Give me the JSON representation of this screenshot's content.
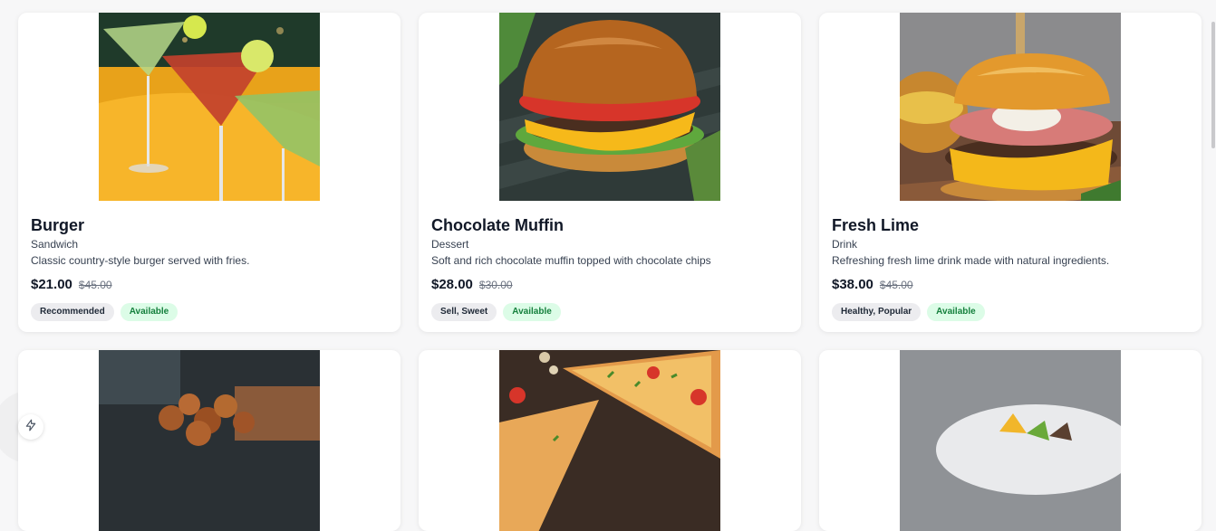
{
  "products": [
    {
      "name": "Burger",
      "category": "Sandwich",
      "description": "Classic country-style burger served with fries.",
      "price": "$21.00",
      "old_price": "$45.00",
      "tag": "Recommended",
      "status": "Available"
    },
    {
      "name": "Chocolate Muffin",
      "category": "Dessert",
      "description": "Soft and rich chocolate muffin topped with chocolate chips",
      "price": "$28.00",
      "old_price": "$30.00",
      "tag": "Sell, Sweet",
      "status": "Available"
    },
    {
      "name": "Fresh Lime",
      "category": "Drink",
      "description": "Refreshing fresh lime drink made with natural ingredients.",
      "price": "$38.00",
      "old_price": "$45.00",
      "tag": "Healthy, Popular",
      "status": "Available"
    }
  ],
  "images": [
    "cocktail-photo",
    "burger-photo",
    "cheese-burger-photo",
    "fried-chicken-photo",
    "pizza-photo",
    "salad-photo"
  ],
  "colors": {
    "available_bg": "#dcfce7",
    "available_text": "#15803d",
    "tag_bg": "#ececef"
  },
  "fab_icon": "bolt-icon"
}
